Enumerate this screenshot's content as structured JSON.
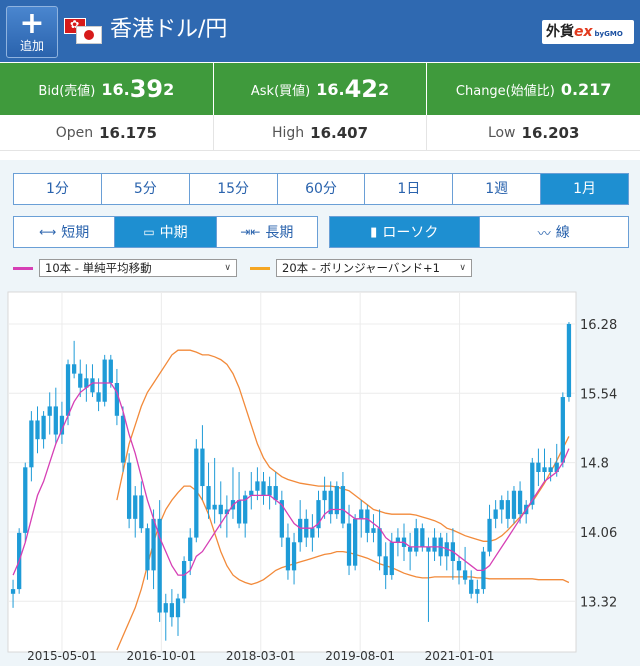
{
  "header": {
    "add_label": "追加",
    "add_icon": "plus-icon",
    "title": "香港ドル/円",
    "brand_prefix": "外貨",
    "brand_ex": "ex",
    "brand_sub": "byGMO"
  },
  "quote": {
    "bid_label": "Bid(売値)",
    "bid_main": "16.39",
    "bid_last": "2",
    "bid_prefix": "16.",
    "ask_label": "Ask(買値)",
    "ask_prefix": "16.",
    "ask_main": "42",
    "ask_last": "2",
    "bid_mid": "39",
    "change_label": "Change(始値比)",
    "change_value": "0.217"
  },
  "stats": {
    "open_label": "Open",
    "open_value": "16.175",
    "high_label": "High",
    "high_value": "16.407",
    "low_label": "Low",
    "low_value": "16.203"
  },
  "period_tabs": [
    "1分",
    "5分",
    "15分",
    "60分",
    "1日",
    "1週",
    "1月"
  ],
  "period_active": "1月",
  "terms": {
    "short": "短期",
    "mid": "中期",
    "long": "長期",
    "candle": "ローソク",
    "line": "線"
  },
  "indicators": {
    "ma_label": "10本 - 単純平均移動",
    "ma_color": "#d63fb5",
    "bb_label": "20本 - ボリンジャーバンド+1",
    "bb_color": "#f5a623"
  },
  "colors": {
    "header": "#2f69b1",
    "quote_green": "#3f9a3c",
    "candle": "#1e9bd7",
    "bb_line": "#f28a3a",
    "ma_line": "#d63fb5"
  },
  "chart_data": {
    "type": "candlestick",
    "y_ticks": [
      "16.28",
      "15.54",
      "14.8",
      "14.06",
      "13.32"
    ],
    "y_tick_values": [
      16.28,
      15.54,
      14.8,
      14.06,
      13.32
    ],
    "ylim": [
      12.8,
      16.6
    ],
    "x_ticks": [
      "2015-05-01",
      "2016-10-01",
      "2018-03-01",
      "2019-08-01",
      "2021-01-01"
    ],
    "grid": true,
    "candles": [
      [
        13.4,
        13.55,
        13.25,
        13.45
      ],
      [
        13.45,
        14.1,
        13.4,
        14.05
      ],
      [
        14.05,
        14.8,
        13.95,
        14.75
      ],
      [
        14.75,
        15.35,
        14.6,
        15.25
      ],
      [
        15.25,
        15.4,
        14.9,
        15.05
      ],
      [
        15.05,
        15.35,
        14.95,
        15.3
      ],
      [
        15.3,
        15.55,
        15.1,
        15.4
      ],
      [
        15.4,
        15.6,
        15.0,
        15.1
      ],
      [
        15.1,
        15.45,
        15.0,
        15.3
      ],
      [
        15.3,
        15.9,
        15.2,
        15.85
      ],
      [
        15.85,
        16.1,
        15.7,
        15.75
      ],
      [
        15.75,
        15.9,
        15.5,
        15.6
      ],
      [
        15.6,
        15.85,
        15.45,
        15.7
      ],
      [
        15.7,
        15.85,
        15.5,
        15.55
      ],
      [
        15.55,
        15.7,
        15.35,
        15.45
      ],
      [
        15.45,
        15.95,
        15.4,
        15.9
      ],
      [
        15.9,
        15.95,
        15.6,
        15.65
      ],
      [
        15.65,
        15.8,
        15.2,
        15.3
      ],
      [
        15.3,
        15.4,
        14.7,
        14.8
      ],
      [
        14.8,
        14.9,
        14.1,
        14.2
      ],
      [
        14.2,
        14.55,
        14.0,
        14.45
      ],
      [
        14.45,
        14.6,
        14.05,
        14.1
      ],
      [
        14.1,
        14.15,
        13.55,
        13.65
      ],
      [
        13.65,
        14.3,
        13.45,
        14.2
      ],
      [
        14.2,
        14.4,
        13.1,
        13.2
      ],
      [
        13.2,
        13.4,
        12.9,
        13.3
      ],
      [
        13.3,
        13.45,
        13.05,
        13.15
      ],
      [
        13.15,
        13.4,
        12.95,
        13.35
      ],
      [
        13.35,
        13.8,
        13.3,
        13.75
      ],
      [
        13.75,
        14.1,
        13.6,
        14.0
      ],
      [
        14.0,
        15.05,
        13.95,
        14.95
      ],
      [
        14.95,
        15.2,
        14.4,
        14.55
      ],
      [
        14.55,
        14.8,
        14.2,
        14.3
      ],
      [
        14.3,
        14.85,
        14.15,
        14.35
      ],
      [
        14.35,
        14.6,
        14.1,
        14.25
      ],
      [
        14.25,
        14.45,
        14.0,
        14.3
      ],
      [
        14.3,
        14.75,
        14.2,
        14.4
      ],
      [
        14.4,
        14.7,
        14.1,
        14.15
      ],
      [
        14.15,
        14.5,
        14.0,
        14.45
      ],
      [
        14.45,
        14.7,
        14.3,
        14.5
      ],
      [
        14.5,
        14.75,
        14.4,
        14.6
      ],
      [
        14.6,
        14.7,
        14.35,
        14.45
      ],
      [
        14.45,
        14.65,
        14.3,
        14.55
      ],
      [
        14.55,
        14.7,
        14.35,
        14.4
      ],
      [
        14.4,
        14.5,
        13.9,
        14.0
      ],
      [
        14.0,
        14.15,
        13.55,
        13.65
      ],
      [
        13.65,
        14.05,
        13.5,
        13.95
      ],
      [
        13.95,
        14.4,
        13.85,
        14.2
      ],
      [
        14.2,
        14.3,
        13.9,
        14.0
      ],
      [
        14.0,
        14.25,
        13.85,
        14.1
      ],
      [
        14.1,
        14.5,
        14.0,
        14.4
      ],
      [
        14.4,
        14.65,
        14.2,
        14.5
      ],
      [
        14.5,
        14.6,
        14.15,
        14.25
      ],
      [
        14.25,
        14.6,
        14.2,
        14.55
      ],
      [
        14.55,
        14.7,
        14.1,
        14.15
      ],
      [
        14.15,
        14.35,
        13.6,
        13.7
      ],
      [
        13.7,
        14.25,
        13.65,
        14.2
      ],
      [
        14.2,
        14.4,
        14.0,
        14.3
      ],
      [
        14.3,
        14.35,
        13.95,
        14.05
      ],
      [
        14.05,
        14.25,
        13.95,
        14.1
      ],
      [
        14.1,
        14.3,
        13.65,
        13.8
      ],
      [
        13.8,
        13.95,
        13.45,
        13.6
      ],
      [
        13.6,
        14.05,
        13.55,
        13.95
      ],
      [
        13.95,
        14.1,
        13.8,
        14.0
      ],
      [
        14.0,
        14.15,
        13.75,
        13.9
      ],
      [
        13.9,
        14.05,
        13.65,
        13.85
      ],
      [
        13.85,
        14.2,
        13.8,
        14.1
      ],
      [
        14.1,
        14.15,
        13.85,
        13.9
      ],
      [
        13.9,
        14.0,
        13.1,
        13.85
      ],
      [
        13.85,
        14.1,
        13.75,
        14.0
      ],
      [
        14.0,
        14.05,
        13.7,
        13.8
      ],
      [
        13.8,
        14.05,
        13.65,
        13.95
      ],
      [
        13.95,
        14.1,
        13.55,
        13.75
      ],
      [
        13.75,
        13.8,
        13.5,
        13.65
      ],
      [
        13.65,
        13.9,
        13.5,
        13.55
      ],
      [
        13.55,
        13.65,
        13.35,
        13.4
      ],
      [
        13.4,
        13.55,
        13.3,
        13.45
      ],
      [
        13.45,
        13.9,
        13.4,
        13.85
      ],
      [
        13.85,
        14.35,
        13.8,
        14.2
      ],
      [
        14.2,
        14.4,
        14.1,
        14.3
      ],
      [
        14.3,
        14.45,
        14.15,
        14.4
      ],
      [
        14.4,
        14.5,
        14.1,
        14.2
      ],
      [
        14.2,
        14.55,
        14.15,
        14.5
      ],
      [
        14.5,
        14.6,
        14.15,
        14.25
      ],
      [
        14.25,
        14.4,
        14.15,
        14.35
      ],
      [
        14.35,
        14.85,
        14.3,
        14.8
      ],
      [
        14.8,
        14.95,
        14.55,
        14.7
      ],
      [
        14.7,
        14.95,
        14.6,
        14.75
      ],
      [
        14.75,
        14.85,
        14.6,
        14.7
      ],
      [
        14.7,
        15.0,
        14.65,
        14.8
      ],
      [
        14.8,
        15.55,
        14.75,
        15.5
      ],
      [
        15.5,
        16.3,
        15.45,
        16.28
      ]
    ],
    "ma10": [
      13.6,
      13.75,
      13.95,
      14.2,
      14.45,
      14.6,
      14.8,
      15.0,
      15.15,
      15.3,
      15.45,
      15.55,
      15.6,
      15.65,
      15.65,
      15.65,
      15.65,
      15.55,
      15.35,
      15.1,
      14.9,
      14.65,
      14.4,
      14.2,
      14.0,
      13.85,
      13.7,
      13.6,
      13.6,
      13.65,
      13.8,
      13.85,
      13.95,
      14.05,
      14.15,
      14.25,
      14.35,
      14.4,
      14.4,
      14.45,
      14.45,
      14.45,
      14.45,
      14.4,
      14.35,
      14.25,
      14.15,
      14.1,
      14.1,
      14.1,
      14.15,
      14.25,
      14.3,
      14.3,
      14.3,
      14.25,
      14.2,
      14.2,
      14.2,
      14.15,
      14.1,
      14.0,
      13.95,
      13.95,
      13.95,
      13.9,
      13.9,
      13.9,
      13.9,
      13.9,
      13.9,
      13.88,
      13.85,
      13.8,
      13.75,
      13.7,
      13.65,
      13.65,
      13.7,
      13.8,
      13.9,
      14.0,
      14.1,
      14.2,
      14.3,
      14.4,
      14.5,
      14.6,
      14.65,
      14.7,
      14.8,
      14.95
    ],
    "bb_upper": [
      14.4,
      14.7,
      15.0,
      15.2,
      15.4,
      15.55,
      15.65,
      15.75,
      15.85,
      15.95,
      16.0,
      16.0,
      16.0,
      15.98,
      15.95,
      15.95,
      15.93,
      15.9,
      15.85,
      15.75,
      15.6,
      15.4,
      15.2,
      15.0,
      14.85,
      14.75,
      14.7,
      14.65,
      14.62,
      14.6,
      14.58,
      14.57,
      14.56,
      14.55,
      14.55,
      14.55,
      14.54,
      14.52,
      14.5,
      14.45,
      14.4,
      14.35,
      14.3,
      14.28,
      14.26,
      14.25,
      14.25,
      14.25,
      14.25,
      14.24,
      14.22,
      14.2,
      14.18,
      14.15,
      14.1,
      14.08,
      14.05,
      14.02,
      14.0,
      13.98,
      13.96,
      13.96,
      13.98,
      14.02,
      14.08,
      14.15,
      14.22,
      14.3,
      14.38,
      14.48,
      14.58,
      14.7,
      14.82,
      14.95,
      15.08
    ],
    "bb_lower": [
      12.8,
      12.95,
      13.1,
      13.25,
      13.45,
      13.7,
      13.95,
      14.15,
      14.3,
      14.4,
      14.48,
      14.55,
      14.55,
      14.5,
      14.4,
      14.25,
      14.05,
      13.85,
      13.7,
      13.6,
      13.55,
      13.52,
      13.5,
      13.52,
      13.55,
      13.6,
      13.65,
      13.68,
      13.7,
      13.72,
      13.74,
      13.76,
      13.78,
      13.8,
      13.82,
      13.83,
      13.85,
      13.85,
      13.84,
      13.82,
      13.8,
      13.78,
      13.75,
      13.72,
      13.7,
      13.68,
      13.65,
      13.62,
      13.6,
      13.58,
      13.57,
      13.57,
      13.58,
      13.58,
      13.58,
      13.58,
      13.58,
      13.58,
      13.58,
      13.57,
      13.57,
      13.56,
      13.56,
      13.56,
      13.56,
      13.56,
      13.56,
      13.56,
      13.56,
      13.55,
      13.55,
      13.55,
      13.55,
      13.55,
      13.52
    ]
  }
}
